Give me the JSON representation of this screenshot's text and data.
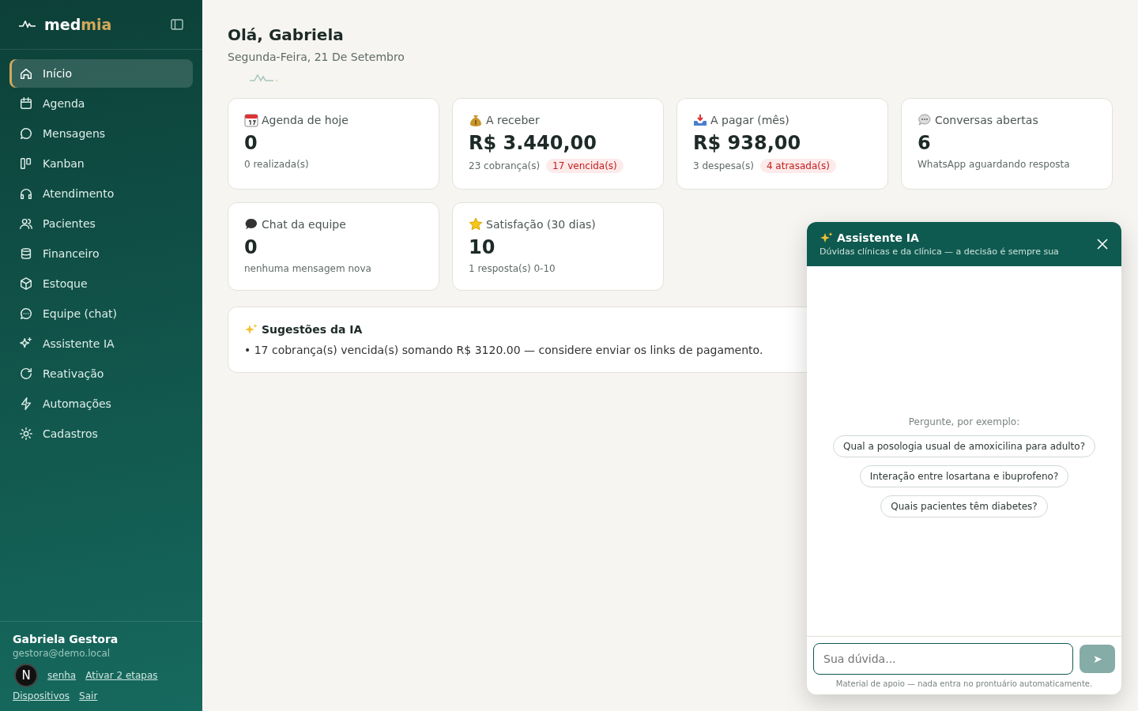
{
  "sidebar": {
    "brand_left": "med",
    "brand_right": "mia",
    "items": [
      {
        "label": "Início",
        "selected": true
      },
      {
        "label": "Agenda",
        "selected": false
      },
      {
        "label": "Mensagens",
        "selected": false
      },
      {
        "label": "Kanban",
        "selected": false
      },
      {
        "label": "Atendimento",
        "selected": false
      },
      {
        "label": "Pacientes",
        "selected": false
      },
      {
        "label": "Financeiro",
        "selected": false
      },
      {
        "label": "Estoque",
        "selected": false
      },
      {
        "label": "Equipe (chat)",
        "selected": false
      },
      {
        "label": "Assistente IA",
        "selected": false
      },
      {
        "label": "Reativação",
        "selected": false
      },
      {
        "label": "Automações",
        "selected": false
      },
      {
        "label": "Cadastros",
        "selected": false
      }
    ],
    "user": {
      "name": "Gabriela Gestora",
      "email": "gestora@demo.local",
      "links_row1": [
        "senha",
        "Ativar 2 etapas"
      ],
      "links_row2": [
        "Dispositivos",
        "Sair"
      ]
    },
    "badge": "N"
  },
  "header": {
    "title": "Olá, Gabriela",
    "date": "Segunda-Feira, 21 De Setembro"
  },
  "cards": [
    {
      "title": "Agenda de hoje",
      "value": "0",
      "note": "0 realizada(s)"
    },
    {
      "title": "A receber",
      "value": "R$ 3.440,00",
      "note": "23 cobrança(s)",
      "alert": "17 vencida(s)"
    },
    {
      "title": "A pagar (mês)",
      "value": "R$ 938,00",
      "note": "3 despesa(s)",
      "alert": "4 atrasada(s)"
    },
    {
      "title": "Conversas abertas",
      "value": "6",
      "note": "WhatsApp aguardando resposta"
    },
    {
      "title": "Chat da equipe",
      "value": "0",
      "note": "nenhuma mensagem nova"
    },
    {
      "title": "Satisfação (30 dias)",
      "value": "10",
      "note": "1 resposta(s) 0-10"
    }
  ],
  "suggestions": {
    "title": "Sugestões da IA",
    "items": [
      "• 17 cobrança(s) vencida(s) somando R$ 3120.00 — considere enviar os links de pagamento."
    ]
  },
  "assistant": {
    "title": "Assistente IA",
    "subtitle": "Dúvidas clínicas e da clínica — a decisão é sempre sua",
    "prompt": "Pergunte, por exemplo:",
    "examples": [
      "Qual a posologia usual de amoxicilina para adulto?",
      "Interação entre losartana e ibuprofeno?",
      "Quais pacientes têm diabetes?"
    ],
    "placeholder": "Sua dúvida...",
    "send": "➤",
    "footnote": "Material de apoio — nada entra no prontuário automaticamente."
  }
}
